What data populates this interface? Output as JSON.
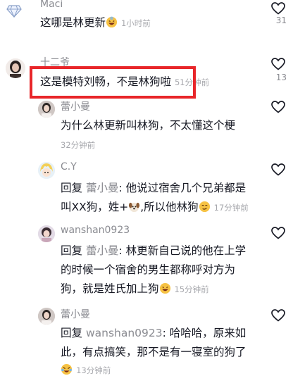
{
  "comments": [
    {
      "name": "Maci",
      "text": "这哪是林更新",
      "time": "1小时前",
      "likes": "31"
    },
    {
      "name": "十二爷",
      "text": "这是模特刘畅，不是林狗啦",
      "time": "51分钟前",
      "likes": "13"
    },
    {
      "name": "蕾小曼",
      "text": "为什么林更新叫林狗，不太懂这个梗",
      "time": "32分钟前"
    },
    {
      "name": "C.Y",
      "reply_kw": "回复",
      "reply_to": "蕾小曼",
      "lines": [
        "他说过宿舍几个兄弟都是",
        "叫XX狗，姓+",
        "所以他林狗"
      ],
      "time": "17分钟前"
    },
    {
      "name": "wanshan0923",
      "reply_kw": "回复",
      "reply_to": "蕾小曼",
      "lines": [
        "林更新自己说的他在上学",
        "的时候一个宿舍的男生都称呼对方为",
        "狗，就是姓氏加上狗"
      ],
      "time": "15分钟前"
    },
    {
      "name": "蕾小曼",
      "reply_kw": "回复",
      "reply_to": "wanshan0923",
      "lines": [
        "哈哈哈，原来如",
        "此，有点搞笑，那不是有一寝室的狗了"
      ],
      "time": "13分钟前"
    }
  ],
  "colors": {
    "highlight": "#e8262a",
    "name": "#8a8b91",
    "text": "#161823",
    "time": "#a7a8ad"
  }
}
